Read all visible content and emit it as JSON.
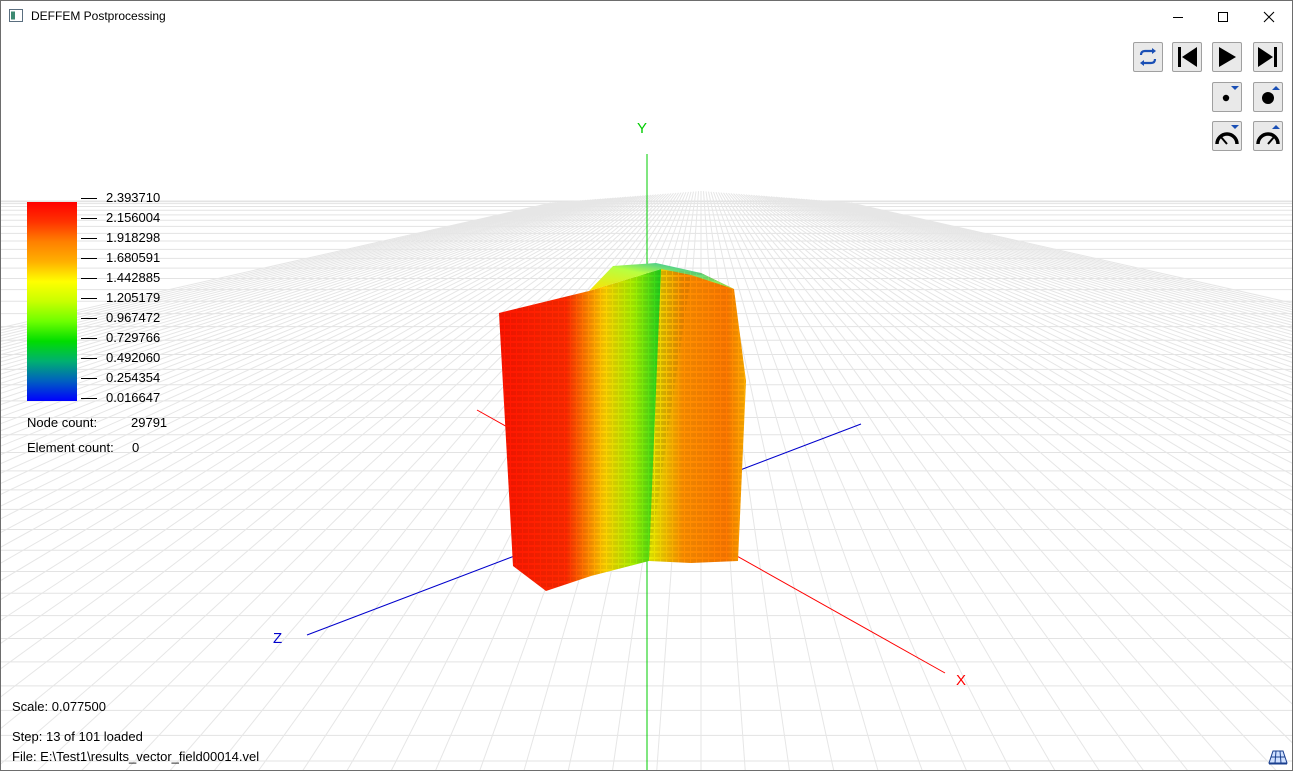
{
  "window": {
    "title": "DEFFEM Postprocessing"
  },
  "legend": {
    "values": [
      "2.393710",
      "2.156004",
      "1.918298",
      "1.680591",
      "1.442885",
      "1.205179",
      "0.967472",
      "0.729766",
      "0.492060",
      "0.254354",
      "0.016647"
    ],
    "colors": [
      "#ff0000",
      "#0000ff"
    ]
  },
  "info": {
    "node_count_label": "Node count:",
    "node_count_value": "29791",
    "element_count_label": "Element count:",
    "element_count_value": "0"
  },
  "status": {
    "scale": "Scale: 0.077500",
    "step": "Step: 13 of 101 loaded",
    "file": "File: E:\\Test1\\results_vector_field00014.vel"
  },
  "axes": {
    "x": "X",
    "y": "Y",
    "z": "Z",
    "x_color": "#ff0000",
    "y_color": "#00cc00",
    "z_color": "#0000cc"
  },
  "toolbar": {
    "loop": "loop-icon",
    "first": "skip-to-start-icon",
    "play": "play-icon",
    "last": "skip-to-end-icon",
    "point_smaller": "point-size-decrease-icon",
    "point_larger": "point-size-increase-icon",
    "speed_slower": "speed-decrease-icon",
    "speed_faster": "speed-increase-icon",
    "grid_toggle": "grid-icon"
  }
}
